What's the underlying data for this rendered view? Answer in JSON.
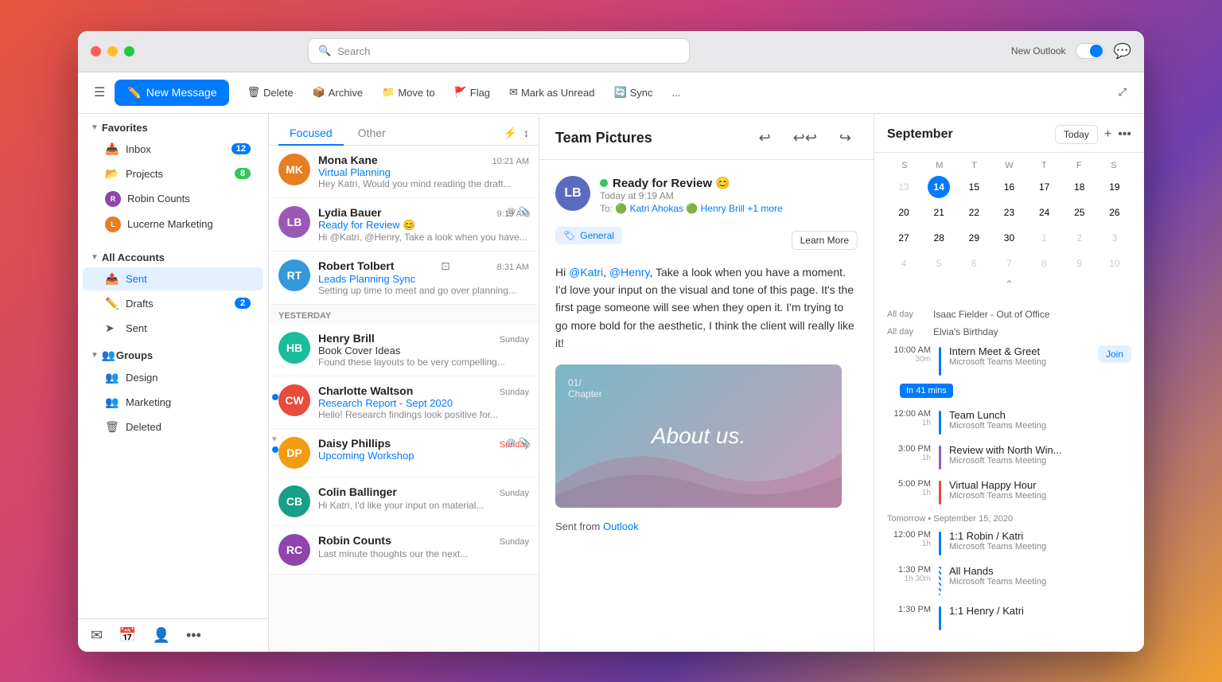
{
  "window": {
    "traffic_lights": [
      "red",
      "yellow",
      "green"
    ],
    "search_placeholder": "Search",
    "new_outlook_label": "New Outlook",
    "toggle_state": "on"
  },
  "toolbar": {
    "new_message_label": "New Message",
    "delete_label": "Delete",
    "archive_label": "Archive",
    "move_to_label": "Move to",
    "flag_label": "Flag",
    "mark_unread_label": "Mark as Unread",
    "sync_label": "Sync",
    "more_label": "..."
  },
  "sidebar": {
    "favorites_label": "Favorites",
    "inbox_label": "Inbox",
    "inbox_count": "12",
    "projects_label": "Projects",
    "projects_count": "8",
    "robin_counts_label": "Robin Counts",
    "lucerne_label": "Lucerne Marketing",
    "all_accounts_label": "All Accounts",
    "sent_label": "Sent",
    "drafts_label": "Drafts",
    "drafts_count": "2",
    "sent_subfolder_label": "Sent",
    "groups_label": "Groups",
    "design_label": "Design",
    "marketing_label": "Marketing",
    "deleted_label": "Deleted"
  },
  "email_list": {
    "focused_tab": "Focused",
    "other_tab": "Other",
    "emails": [
      {
        "sender": "Mona Kane",
        "subject": "Virtual Planning",
        "preview": "Hey Katri, Would you mind reading the draft...",
        "time": "10:21 AM",
        "avatar_color": "#e67e22",
        "initials": "MK",
        "has_dot": false
      },
      {
        "sender": "Lydia Bauer",
        "subject": "Ready for Review 😊",
        "preview": "Hi @Katri, @Henry, Take a look when you have...",
        "time": "9:19 AM",
        "avatar_color": "#9b59b6",
        "initials": "LB",
        "has_dot": false,
        "has_at": true,
        "has_attach": true
      },
      {
        "sender": "Robert Tolbert",
        "subject": "Leads Planning Sync",
        "preview": "Setting up time to meet and go over planning...",
        "time": "8:31 AM",
        "avatar_color": "#3498db",
        "initials": "RT",
        "has_dot": false
      }
    ],
    "yesterday_label": "Yesterday",
    "yesterday_emails": [
      {
        "sender": "Henry Brill",
        "subject": "Book Cover Ideas",
        "preview": "Found these layouts to be very compelling...",
        "time": "Sunday",
        "avatar_color": "#1abc9c",
        "initials": "HB",
        "has_dot": false
      },
      {
        "sender": "Charlotte Waltson",
        "subject": "Research Report - Sept 2020",
        "preview": "Hello! Research findings look positive for...",
        "time": "Sunday",
        "avatar_color": "#e74c3c",
        "initials": "CW",
        "has_dot": true
      },
      {
        "sender": "Daisy Phillips",
        "subject": "Upcoming Workshop",
        "preview": "",
        "time": "Sunday",
        "avatar_color": "#f39c12",
        "initials": "DP",
        "has_dot": true,
        "has_at": true,
        "has_attach": true,
        "is_selected": false
      },
      {
        "sender": "Colin Ballinger",
        "subject": "",
        "preview": "Hi Katri, I'd like your input on material...",
        "time": "Sunday",
        "avatar_color": "#16a085",
        "initials": "CB",
        "has_dot": false
      },
      {
        "sender": "Robin Counts",
        "subject": "",
        "preview": "Last minute thoughts our the next...",
        "time": "Sunday",
        "avatar_color": "#8e44ad",
        "initials": "RC",
        "has_dot": false
      }
    ]
  },
  "email_reader": {
    "title": "Team Pictures",
    "sender_name": "Lydia Bauer",
    "sender_status": "online",
    "sender_initials": "LB",
    "subject": "Ready for Review 😊",
    "time": "Today at 9:19 AM",
    "to_label": "To:",
    "to_recipients": [
      {
        "name": "Katri Ahokas",
        "status": "online"
      },
      {
        "name": "Henry Brill",
        "status": "online"
      },
      {
        "name": "+1 more"
      }
    ],
    "general_label": "General",
    "learn_more_label": "Learn More",
    "body": "Hi @Katri, @Henry, Take a look when you have a moment. I'd love your input on the visual and tone of this page. It's the first page someone will see when they open it. I'm trying to go more bold for the aesthetic, I think the client will really like it!",
    "chapter_label": "01/\nChapter",
    "about_us_label": "About us.",
    "sent_from_label": "Sent from",
    "outlook_label": "Outlook"
  },
  "calendar": {
    "month_title": "September",
    "today_label": "Today",
    "days_header": [
      "S",
      "M",
      "T",
      "W",
      "T",
      "F",
      "S"
    ],
    "weeks": [
      [
        {
          "day": 13,
          "other": true
        },
        {
          "day": 14,
          "today": true
        },
        {
          "day": 15
        },
        {
          "day": 16
        },
        {
          "day": 17
        },
        {
          "day": 18
        },
        {
          "day": 19
        }
      ],
      [
        {
          "day": 20
        },
        {
          "day": 21
        },
        {
          "day": 22
        },
        {
          "day": 23
        },
        {
          "day": 24
        },
        {
          "day": 25
        },
        {
          "day": 26
        }
      ],
      [
        {
          "day": 27
        },
        {
          "day": 28
        },
        {
          "day": 29
        },
        {
          "day": 30
        },
        {
          "day": 1,
          "other": true
        },
        {
          "day": 2,
          "other": true
        },
        {
          "day": 3,
          "other": true
        }
      ],
      [
        {
          "day": 4,
          "other": true
        },
        {
          "day": 5,
          "other": true
        },
        {
          "day": 6,
          "other": true
        },
        {
          "day": 7,
          "other": true
        },
        {
          "day": 8,
          "other": true
        },
        {
          "day": 9,
          "other": true
        },
        {
          "day": 10,
          "other": true
        }
      ]
    ],
    "allday_events": [
      {
        "label": "All day",
        "title": "Isaac Fielder - Out of Office"
      },
      {
        "label": "All day",
        "title": "Elvia's Birthday"
      }
    ],
    "events": [
      {
        "time": "10:00 AM",
        "duration": "30m",
        "title": "Intern Meet & Greet",
        "subtitle": "Microsoft Teams Meeting",
        "color": "#007AFF",
        "has_join": true,
        "has_in_mins": true,
        "in_mins_label": "In 41 mins"
      },
      {
        "time": "12:00 AM",
        "duration": "1h",
        "title": "Team Lunch",
        "subtitle": "Microsoft Teams Meeting",
        "color": "#007AFF"
      },
      {
        "time": "3:00 PM",
        "duration": "1h",
        "title": "Review with North Win...",
        "subtitle": "Microsoft Teams Meeting",
        "color": "#9b59b6"
      },
      {
        "time": "5:00 PM",
        "duration": "1h",
        "title": "Virtual Happy Hour",
        "subtitle": "Microsoft Teams Meeting",
        "color": "#e74c3c"
      }
    ],
    "tomorrow_label": "Tomorrow • September 15, 2020",
    "tomorrow_events": [
      {
        "time": "12:00 PM",
        "duration": "1h",
        "title": "1:1 Robin / Katri",
        "subtitle": "Microsoft Teams Meeting",
        "color": "#007AFF"
      },
      {
        "time": "1:30 PM",
        "duration": "1h 30m",
        "title": "All Hands",
        "subtitle": "Microsoft Teams Meeting",
        "color": "#007AFF",
        "striped": true
      },
      {
        "time": "1:30 PM",
        "duration": "",
        "title": "1:1 Henry / Katri",
        "subtitle": "",
        "color": "#007AFF"
      }
    ]
  }
}
